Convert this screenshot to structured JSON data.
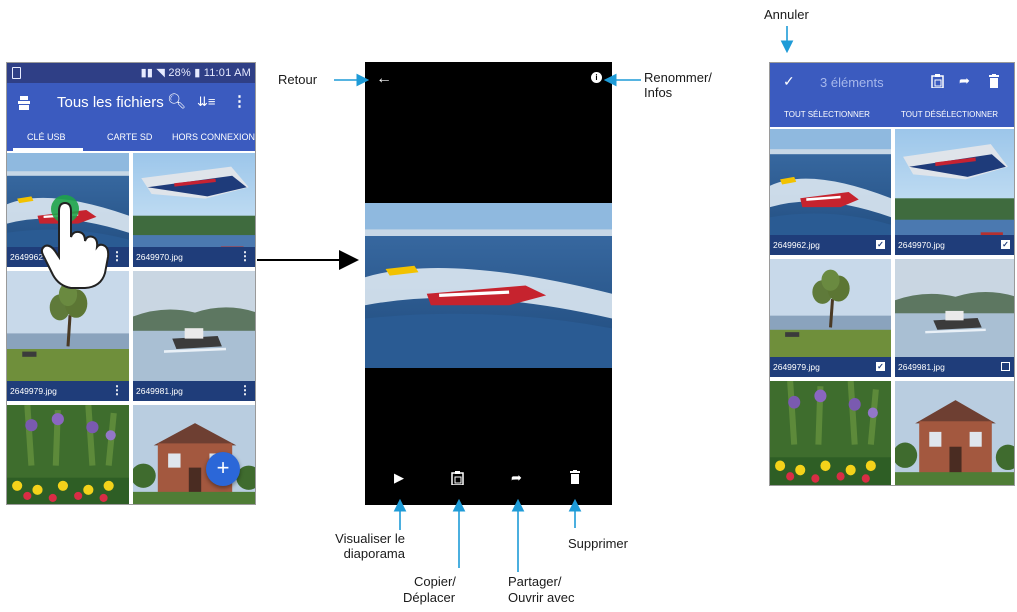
{
  "phone1": {
    "status_time": "11:01 AM",
    "status_battery": "28%",
    "title": "Tous les fichiers",
    "tabs": [
      "CLÉ USB",
      "CARTE SD",
      "HORS CONNEXION"
    ],
    "files": [
      {
        "name": "2649962.jpg",
        "thumb": "boat-racing"
      },
      {
        "name": "2649970.jpg",
        "thumb": "hydroplane-lake"
      },
      {
        "name": "2649979.jpg",
        "thumb": "tree-lake"
      },
      {
        "name": "2649981.jpg",
        "thumb": "boat-lake"
      },
      {
        "name": "",
        "thumb": "flowers"
      },
      {
        "name": "",
        "thumb": "house"
      }
    ],
    "fab_label": "+"
  },
  "phone2": {
    "back_icon": "arrow-left-icon",
    "info_icon": "info-icon",
    "toolbar_icons": [
      "play-icon",
      "copy-move-icon",
      "share-icon",
      "delete-icon"
    ]
  },
  "phone3": {
    "count_label": "3 éléments",
    "select_all": "TOUT SÉLECTIONNER",
    "deselect_all": "TOUT DÉSÉLECTIONNER",
    "files": [
      {
        "name": "2649962.jpg",
        "checked": true
      },
      {
        "name": "2649970.jpg",
        "checked": true
      },
      {
        "name": "2649979.jpg",
        "checked": true
      },
      {
        "name": "2649981.jpg",
        "checked": false
      }
    ]
  },
  "annotations": {
    "annuler": "Annuler",
    "retour": "Retour",
    "renommer_1": "Renommer/",
    "renommer_2": "Infos",
    "visualiser_1": "Visualiser le",
    "visualiser_2": "diaporama",
    "copier_1": "Copier/",
    "copier_2": "Déplacer",
    "partager_1": "Partager/",
    "partager_2": "Ouvrir avec",
    "supprimer": "Supprimer"
  },
  "colors": {
    "appbar": "#3b5bbf",
    "statusbar": "#2f3f86",
    "caption": "#1f3d7a",
    "annotation_arrow": "#1e9bd7",
    "fab": "#2b67d8"
  }
}
